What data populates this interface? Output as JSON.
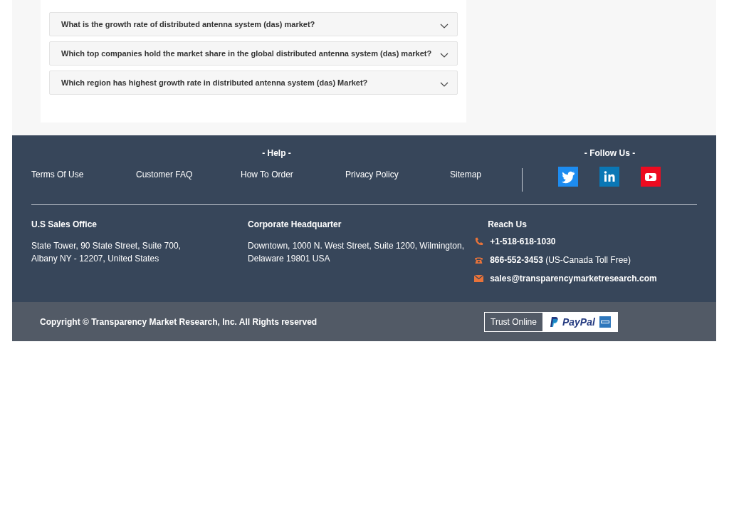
{
  "faq": [
    {
      "question": "What is the growth rate of distributed antenna system (das) market?",
      "expanded": false
    },
    {
      "question": "Which top companies hold the market share in the global distributed antenna system (das) market?",
      "expanded": false
    },
    {
      "question": "Which region has highest growth rate in distributed antenna system (das) Market?",
      "expanded": false
    }
  ],
  "footer": {
    "help_heading": "- Help -",
    "links": [
      "Terms Of Use",
      "Customer FAQ",
      "How To Order",
      "Privacy Policy",
      "Sitemap"
    ],
    "follow_heading": "- Follow Us -",
    "social": [
      {
        "kind": "twitter",
        "color": "#1d8cf0"
      },
      {
        "kind": "linkedin",
        "color": "#0a77b5"
      },
      {
        "kind": "youtube",
        "color": "#ed0b20"
      }
    ],
    "offices": [
      {
        "heading": "U.S Sales Office",
        "lines": [
          "State Tower, 90 State Street, Suite 700,",
          "Albany NY - 12207, United States"
        ]
      },
      {
        "heading": "Corporate Headquarter",
        "lines": [
          "Downtown, 1000 N. West Street, Suite 1200, Wilmington,",
          "Delaware 19801 USA"
        ]
      }
    ],
    "reach_heading": "Reach Us",
    "contacts": [
      {
        "kind": "phone",
        "text": "**+1-518-618-1030**"
      },
      {
        "kind": "tollfree",
        "text": "**866-552-3453** (US-Canada Toll Free)"
      },
      {
        "kind": "email",
        "text": "**sales@transparencymarketresearch.com**"
      }
    ],
    "copyright": "Copyright © Transparency Market Research, Inc. All Rights reserved",
    "trust_label": "Trust Online",
    "paypal": "PayPal"
  }
}
